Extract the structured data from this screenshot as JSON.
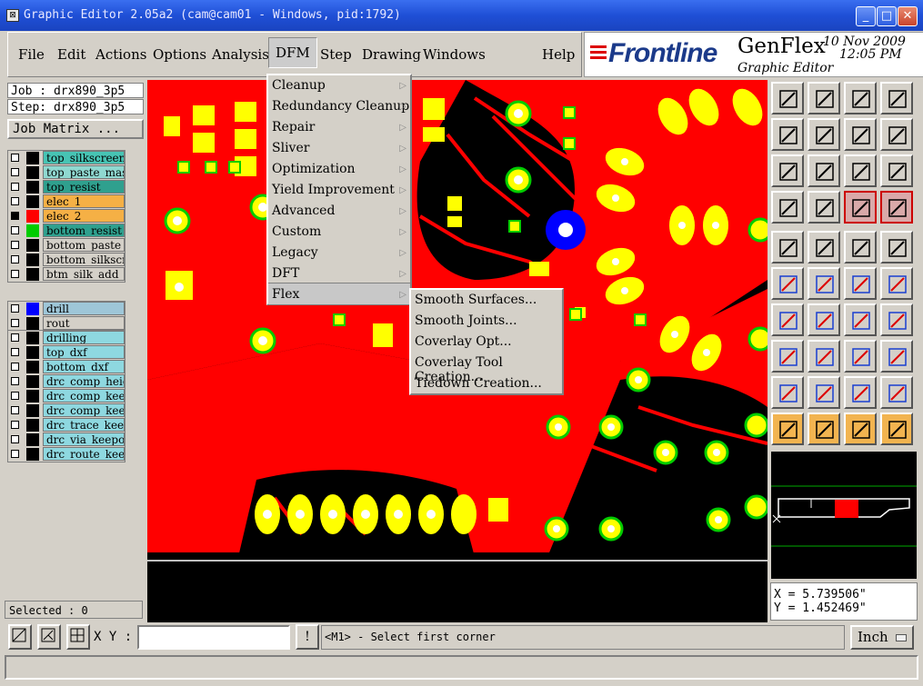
{
  "window": {
    "title": "Graphic Editor 2.05a2 (cam@cam01 - Windows, pid:1792)",
    "minimize": "_",
    "maximize": "□",
    "close": "✕"
  },
  "menubar": {
    "items": [
      "File",
      "Edit",
      "Actions",
      "Options",
      "Analysis",
      "DFM",
      "Step",
      "Drawing",
      "Windows",
      "Help"
    ],
    "active": "DFM"
  },
  "brand": {
    "logo": "Frontline",
    "product": "GenFlex",
    "subtitle": "Graphic Editor",
    "date": "10 Nov 2009",
    "time": "12:05 PM"
  },
  "job": {
    "job_line": "Job : drx890_3p5",
    "step_line": "Step: drx890_3p5",
    "matrix_button": "Job Matrix ..."
  },
  "layers": {
    "group1": [
      {
        "name": "top_silkscreen",
        "color": "#47c4b4",
        "checked": false,
        "swatch": ""
      },
      {
        "name": "top_paste_mask",
        "color": "#8fd8d0",
        "checked": false,
        "swatch": ""
      },
      {
        "name": "top_resist",
        "color": "#2fa08e",
        "checked": false,
        "swatch": ""
      },
      {
        "name": "elec_1",
        "color": "#f5b045",
        "checked": false,
        "swatch": ""
      },
      {
        "name": "elec_2",
        "color": "#f5b045",
        "checked": true,
        "swatch": "#ff0000"
      },
      {
        "name": "bottom_resist",
        "color": "#2fa08e",
        "checked": false,
        "swatch": "#00cc00"
      },
      {
        "name": "bottom_paste",
        "color": "#d4d0c8",
        "checked": false,
        "swatch": ""
      },
      {
        "name": "bottom_silkscreen",
        "color": "#d4d0c8",
        "checked": false,
        "swatch": ""
      },
      {
        "name": "btm_silk_add",
        "color": "#d4d0c8",
        "checked": false,
        "swatch": ""
      }
    ],
    "group2": [
      {
        "name": "drill",
        "color": "#9ec6d8",
        "checked": false,
        "swatch": "#0000ff"
      },
      {
        "name": "rout",
        "color": "#d4d0c8",
        "checked": false,
        "swatch": ""
      }
    ],
    "group3": [
      {
        "name": "drilling",
        "color": "#8ed8e0",
        "checked": false,
        "swatch": ""
      },
      {
        "name": "top_dxf",
        "color": "#8ed8e0",
        "checked": false,
        "swatch": ""
      },
      {
        "name": "bottom_dxf",
        "color": "#8ed8e0",
        "checked": false,
        "swatch": ""
      },
      {
        "name": "drc_comp_height",
        "color": "#8ed8e0",
        "checked": false,
        "swatch": ""
      },
      {
        "name": "drc_comp_keepin",
        "color": "#8ed8e0",
        "checked": false,
        "swatch": ""
      },
      {
        "name": "drc_comp_keepout",
        "color": "#8ed8e0",
        "checked": false,
        "swatch": ""
      },
      {
        "name": "drc_trace_keepout",
        "color": "#8ed8e0",
        "checked": false,
        "swatch": ""
      },
      {
        "name": "drc_via_keepout",
        "color": "#8ed8e0",
        "checked": false,
        "swatch": ""
      },
      {
        "name": "drc_route_keepout",
        "color": "#8ed8e0",
        "checked": false,
        "swatch": ""
      }
    ]
  },
  "selected_text": "Selected : 0",
  "dfm_menu": {
    "items": [
      "Cleanup",
      "Redundancy Cleanup",
      "Repair",
      "Sliver",
      "Optimization",
      "Yield Improvement",
      "Advanced",
      "Custom",
      "Legacy",
      "DFT",
      "Flex"
    ],
    "highlighted": "Flex"
  },
  "flex_submenu": {
    "items": [
      "Smooth Surfaces...",
      "Smooth Joints...",
      "Coverlay Opt...",
      "Coverlay Tool Creation...",
      "Tiedown Creation..."
    ]
  },
  "coordinates": {
    "x_line": "X = 5.739506\"",
    "y_line": "Y = 1.452469\""
  },
  "bottom": {
    "xy_label": "X Y :",
    "xy_value": "",
    "exclaim": "!",
    "prompt": "<M1> - Select first corner",
    "units": "Inch"
  },
  "colors": {
    "board": "#ff0000",
    "copper": "#ffff00",
    "trace": "#ff0000",
    "background": "#000000",
    "via_ring": "#00cc00",
    "drill": "#0000ff"
  }
}
